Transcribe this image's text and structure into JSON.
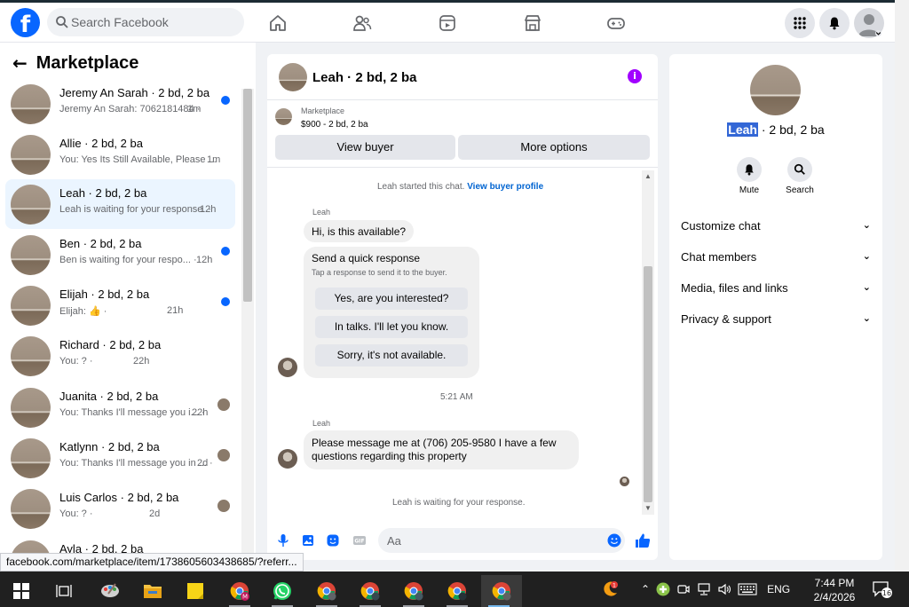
{
  "header": {
    "logo": "f",
    "search_placeholder": "Search Facebook",
    "nav": [
      "home-icon",
      "friends-icon",
      "watch-icon",
      "marketplace-icon",
      "gaming-icon"
    ],
    "menu_icon": "grid-icon",
    "notif_icon": "bell-icon"
  },
  "sidebar": {
    "back": "←",
    "title": "Marketplace",
    "conversations": [
      {
        "name": "Jeremy An Sarah · 2 bd, 2 ba",
        "snippet": "Jeremy An Sarah: 7062181484 ·",
        "time": "1m",
        "unread": true
      },
      {
        "name": "Allie · 2 bd, 2 ba",
        "snippet": "You: Yes Its Still Available, Please ...",
        "time": "1m"
      },
      {
        "name": "Leah · 2 bd, 2 ba",
        "snippet": "Leah is waiting for your response. ·",
        "time": "12h",
        "active": true
      },
      {
        "name": "Ben · 2 bd, 2 ba",
        "snippet": "Ben is waiting for your respo... ·",
        "time": "12h",
        "unread": true
      },
      {
        "name": "Elijah · 2 bd, 2 ba",
        "snippet": "Elijah: 👍 ·",
        "time": "21h",
        "unread": true
      },
      {
        "name": "Richard · 2 bd, 2 ba",
        "snippet": "You: ? ·",
        "time": "22h"
      },
      {
        "name": "Juanita · 2 bd, 2 ba",
        "snippet": "You: Thanks I'll message you i... ·",
        "time": "22h"
      },
      {
        "name": "Katlynn · 2 bd, 2 ba",
        "snippet": "You: Thanks I'll message you in ... ·",
        "time": "2d"
      },
      {
        "name": "Luis Carlos · 2 bd, 2 ba",
        "snippet": "You: ? ·",
        "time": "2d"
      },
      {
        "name": "Ayla · 2 bd, 2 ba",
        "snippet": "",
        "time": ""
      }
    ]
  },
  "status_url": "facebook.com/marketplace/item/1738605603438685/?referr...",
  "chat": {
    "title": "Leah · 2 bd, 2 ba",
    "info_icon": "i",
    "listing": {
      "label": "Marketplace",
      "price_line": "$900 - 2 bd, 2 ba"
    },
    "view_buyer": "View buyer",
    "more_options": "More options",
    "started": "Leah started this chat.",
    "view_profile": "View buyer profile",
    "sender1": "Leah",
    "msg1": "Hi, is this available?",
    "quick_title": "Send a quick response",
    "quick_sub": "Tap a response to send it to the buyer.",
    "quick_options": [
      "Yes, are you interested?",
      "In talks. I'll let you know.",
      "Sorry, it's not available."
    ],
    "timestamp": "5:21 AM",
    "sender2": "Leah",
    "msg2_line1": "Please message me at (706) 205-9580 I have a few",
    "msg2_line2": "questions regarding this property",
    "waiting": "Leah is waiting for your response.",
    "composer_placeholder": "Aa"
  },
  "details": {
    "name_highlight": "Leah",
    "name_rest": " · 2 bd, 2 ba",
    "mute": "Mute",
    "search": "Search",
    "sections": [
      "Customize chat",
      "Chat members",
      "Media, files and links",
      "Privacy & support"
    ]
  },
  "taskbar": {
    "lang": "ENG",
    "time": "7:44 PM",
    "date": "2/4/2026",
    "notif_count": "16",
    "weather_badge": "1",
    "chrome_badge": "M"
  },
  "colors": {
    "brand": "#0866ff",
    "accent_purple": "#a100ff",
    "taskbar": "#202020"
  }
}
